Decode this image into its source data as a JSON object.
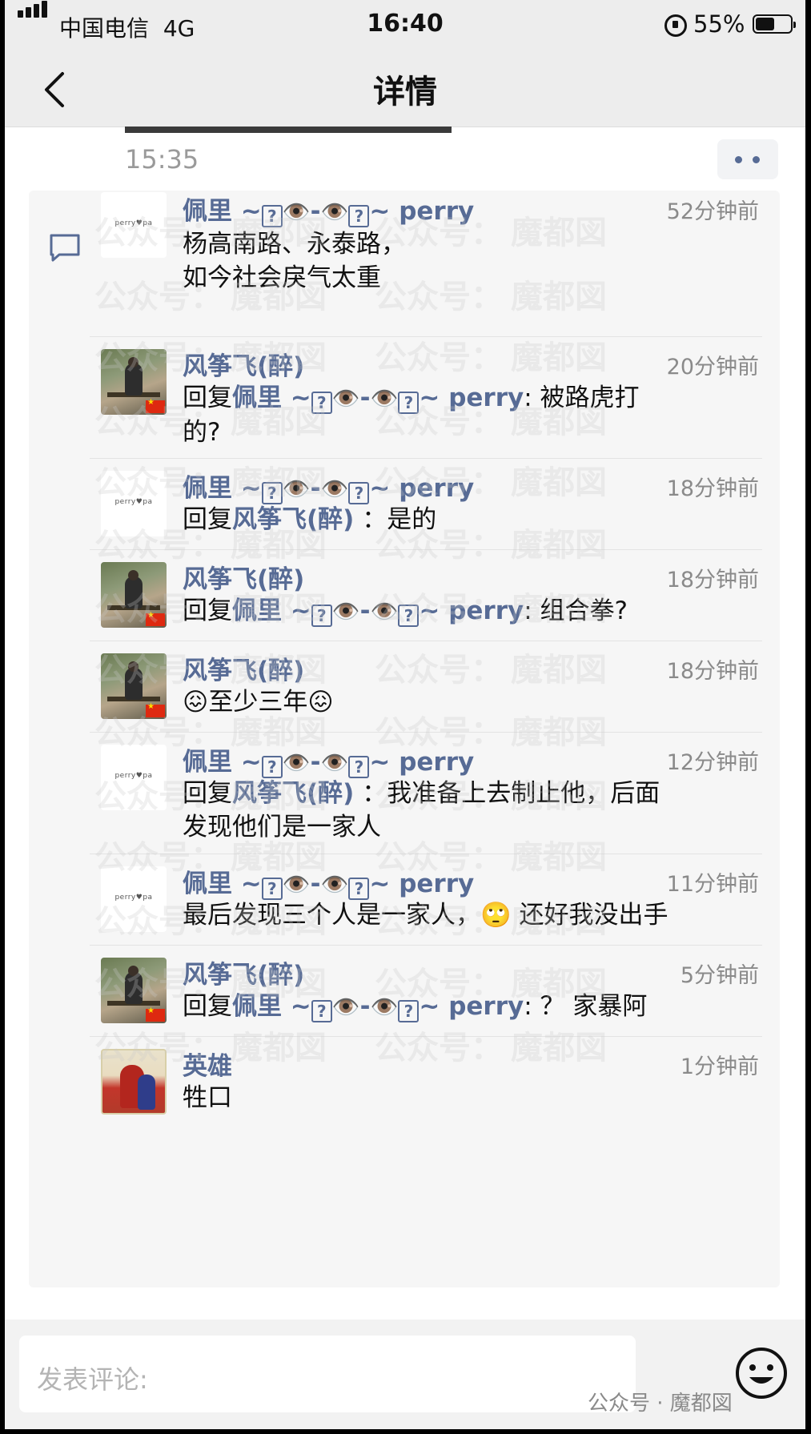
{
  "status_bar": {
    "carrier": "中国电信",
    "network": "4G",
    "time": "16:40",
    "battery": "55%",
    "battery_level": 0.55
  },
  "nav": {
    "title": "详情",
    "back_icon": "chevron-left-icon"
  },
  "post": {
    "time": "15:35",
    "more_icon": "ellipsis-icon"
  },
  "comments": [
    {
      "name": "佩里",
      "ago": "52分钟前",
      "text": "杨高南路、永泰路，\n如今社会戾气太重"
    },
    {
      "name": "风筝飞(醉)",
      "ago": "20分钟前",
      "reply_prefix": "回复",
      "reply_to": "佩里",
      "text": "被路虎打\n的?"
    },
    {
      "name": "佩里",
      "ago": "18分钟前",
      "reply_prefix": "回复",
      "reply_to": "风筝飞(醉)",
      "text": "是的"
    },
    {
      "name": "风筝飞(醉)",
      "ago": "18分钟前",
      "reply_prefix": "回复",
      "reply_to": "佩里",
      "text": "组合拳?"
    },
    {
      "name": "风筝飞(醉)",
      "ago": "18分钟前",
      "text": "😖至少三年😖"
    },
    {
      "name": "佩里",
      "ago": "12分钟前",
      "reply_prefix": "回复",
      "reply_to": "风筝飞(醉)",
      "text": "我准备上去制止他，后面\n发现他们是一家人"
    },
    {
      "name": "佩里",
      "ago": "11分钟前",
      "text": "最后发现三个人是一家人，🙄 还好我没出手"
    },
    {
      "name": "风筝飞(醉)",
      "ago": "5分钟前",
      "reply_prefix": "回复",
      "reply_to": "佩里",
      "text": "？ 家暴阿"
    },
    {
      "name": "英雄",
      "ago": "1分钟前",
      "text": "牲口"
    }
  ],
  "perry_suffix": "~?👁️-👁️?~ perry",
  "perry_logo": "perry♥pa",
  "input": {
    "placeholder": "发表评论:"
  },
  "watermark": {
    "left": "公众号：",
    "right": "魔都図"
  },
  "footer_watermark": "公众号 · 魔都図",
  "colors": {
    "link": "#576b95",
    "panel": "#f6f6f6",
    "nav": "#ededed"
  }
}
